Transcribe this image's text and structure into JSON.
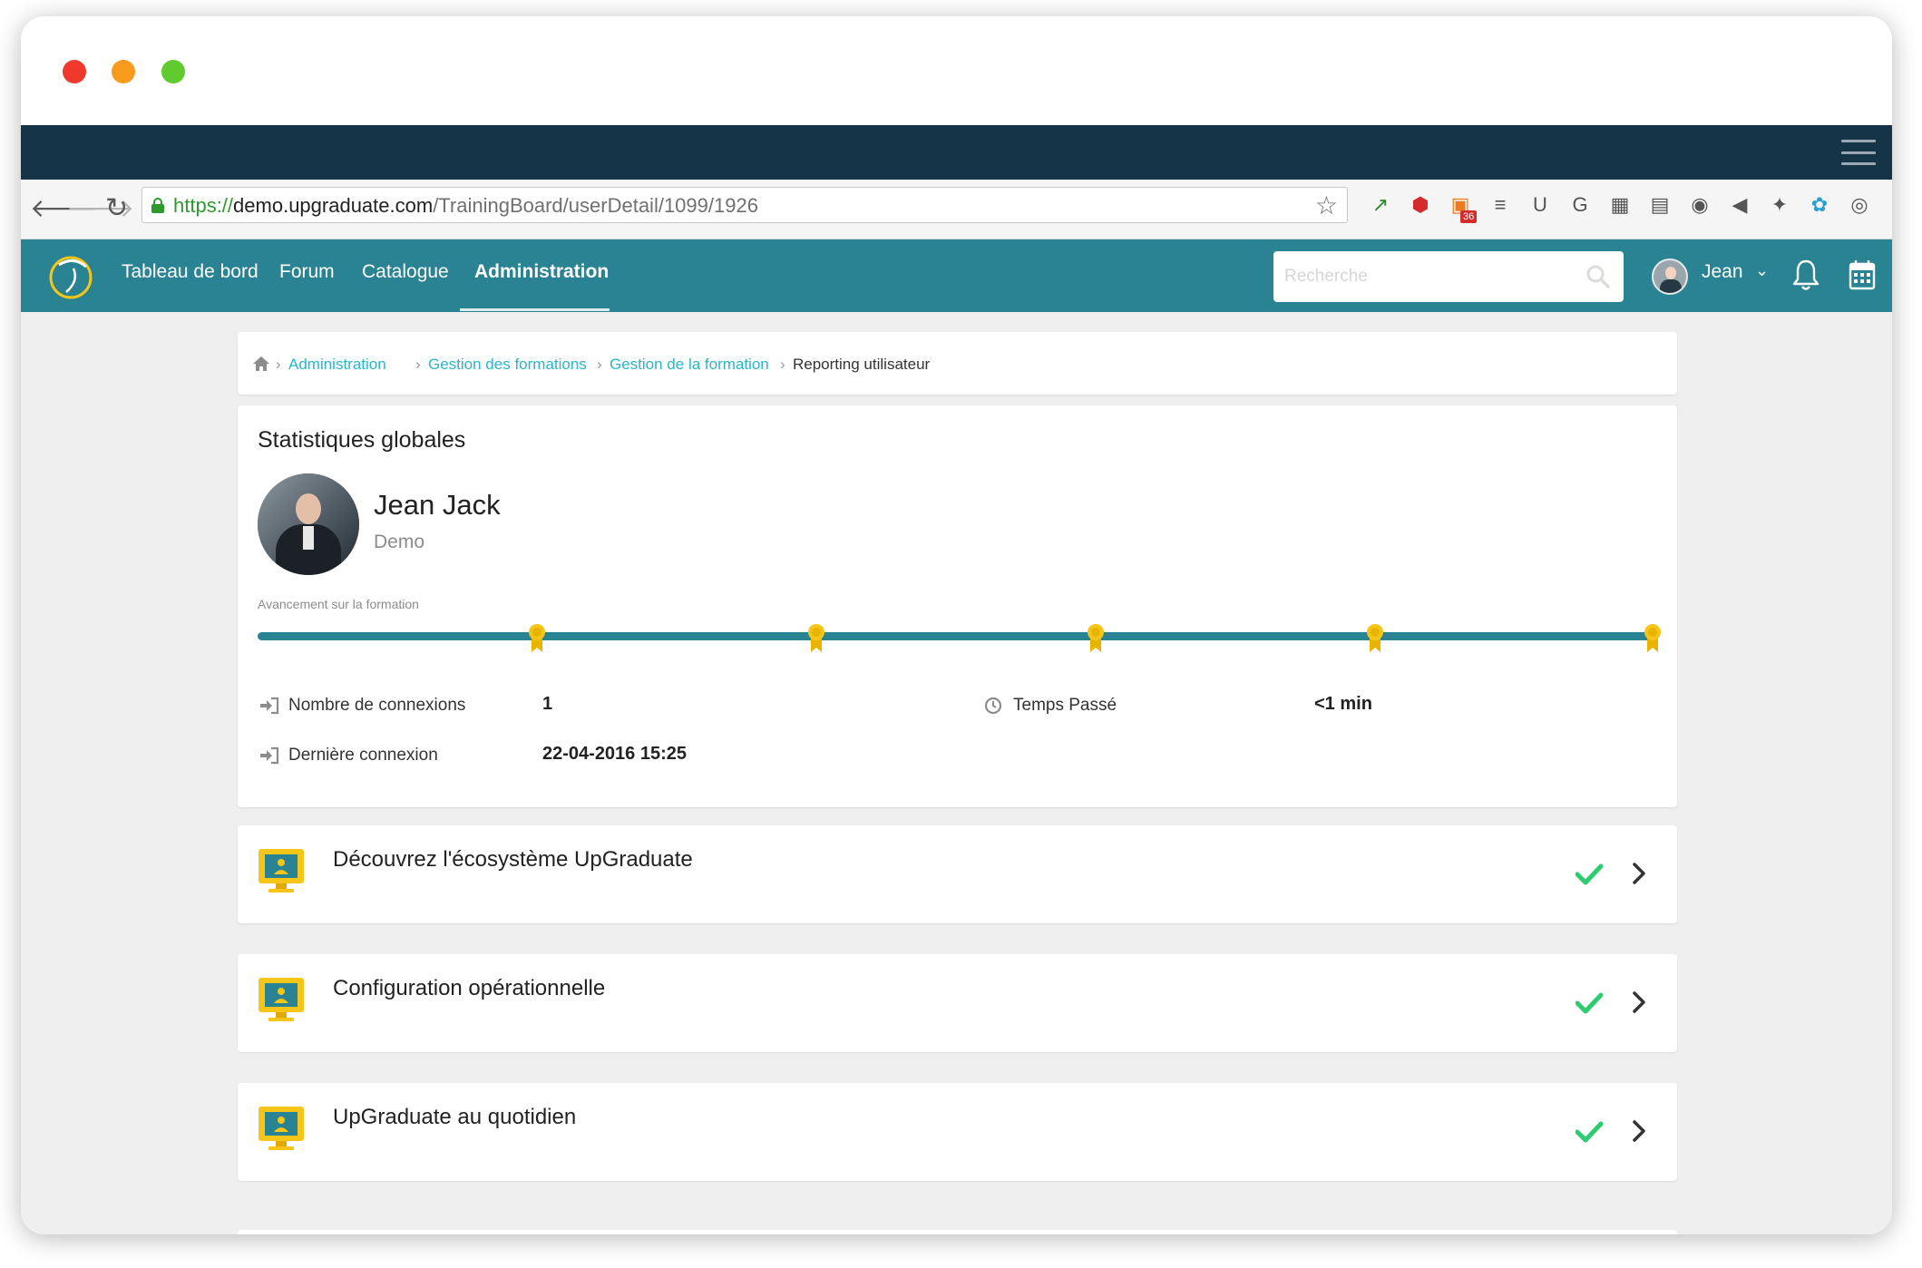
{
  "browser": {
    "url_scheme": "https://",
    "url_host": "demo.upgraduate.com",
    "url_path": "/TrainingBoard/userDetail/1099/1926",
    "extensions": [
      "colorzilla-icon",
      "ublock-icon",
      "feedly-icon",
      "buffer-icon",
      "upwork-icon",
      "google-translate-icon",
      "qr-code-icon",
      "film-icon",
      "record-icon",
      "speaker-icon",
      "pin-icon",
      "palette-icon",
      "circle-icon"
    ],
    "badge_count": "36"
  },
  "nav": {
    "items": [
      {
        "label": "Tableau de bord"
      },
      {
        "label": "Forum"
      },
      {
        "label": "Catalogue"
      },
      {
        "label": "Administration"
      }
    ],
    "search_placeholder": "Recherche",
    "user_name": "Jean",
    "colors": {
      "bar": "#2a8393",
      "accent": "#2bb6c8"
    }
  },
  "breadcrumb": {
    "items": [
      "Administration",
      "Gestion des formations",
      "Gestion de la formation"
    ],
    "current": "Reporting utilisateur"
  },
  "stats": {
    "title": "Statistiques globales",
    "user_name": "Jean Jack",
    "user_org": "Demo",
    "progress_label": "Avancement sur la formation",
    "progress_fraction": 1.0,
    "milestones": 5,
    "connections_label": "Nombre de connexions",
    "connections_value": "1",
    "time_label": "Temps Passé",
    "time_value": "<1 min",
    "last_connection_label": "Dernière connexion",
    "last_connection_value": "22-04-2016 15:25"
  },
  "modules": [
    {
      "title": "Découvrez l'écosystème UpGraduate",
      "completed": true
    },
    {
      "title": "Configuration opérationnelle",
      "completed": true
    },
    {
      "title": "UpGraduate au quotidien",
      "completed": true
    }
  ]
}
